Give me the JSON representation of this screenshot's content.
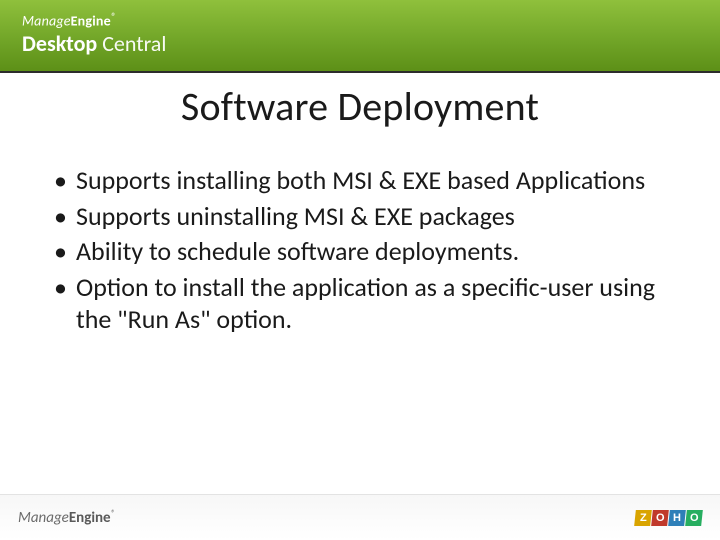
{
  "header": {
    "brand_line1_a": "Manage",
    "brand_line1_b": "Engine",
    "brand_reg": "®",
    "product_a": "Desktop",
    "product_b": " Central"
  },
  "slide": {
    "title": "Software Deployment",
    "bullets": [
      "Supports installing both MSI & EXE based Applications",
      "Supports uninstalling MSI & EXE packages",
      "Ability to schedule software deployments.",
      "Option to install the application as a specific-user using the \"Run As\" option."
    ]
  },
  "footer": {
    "brand_a": "Manage",
    "brand_b": "Engine",
    "brand_reg": "®",
    "zoho": {
      "z": "Z",
      "o1": "O",
      "h": "H",
      "o2": "O"
    }
  }
}
